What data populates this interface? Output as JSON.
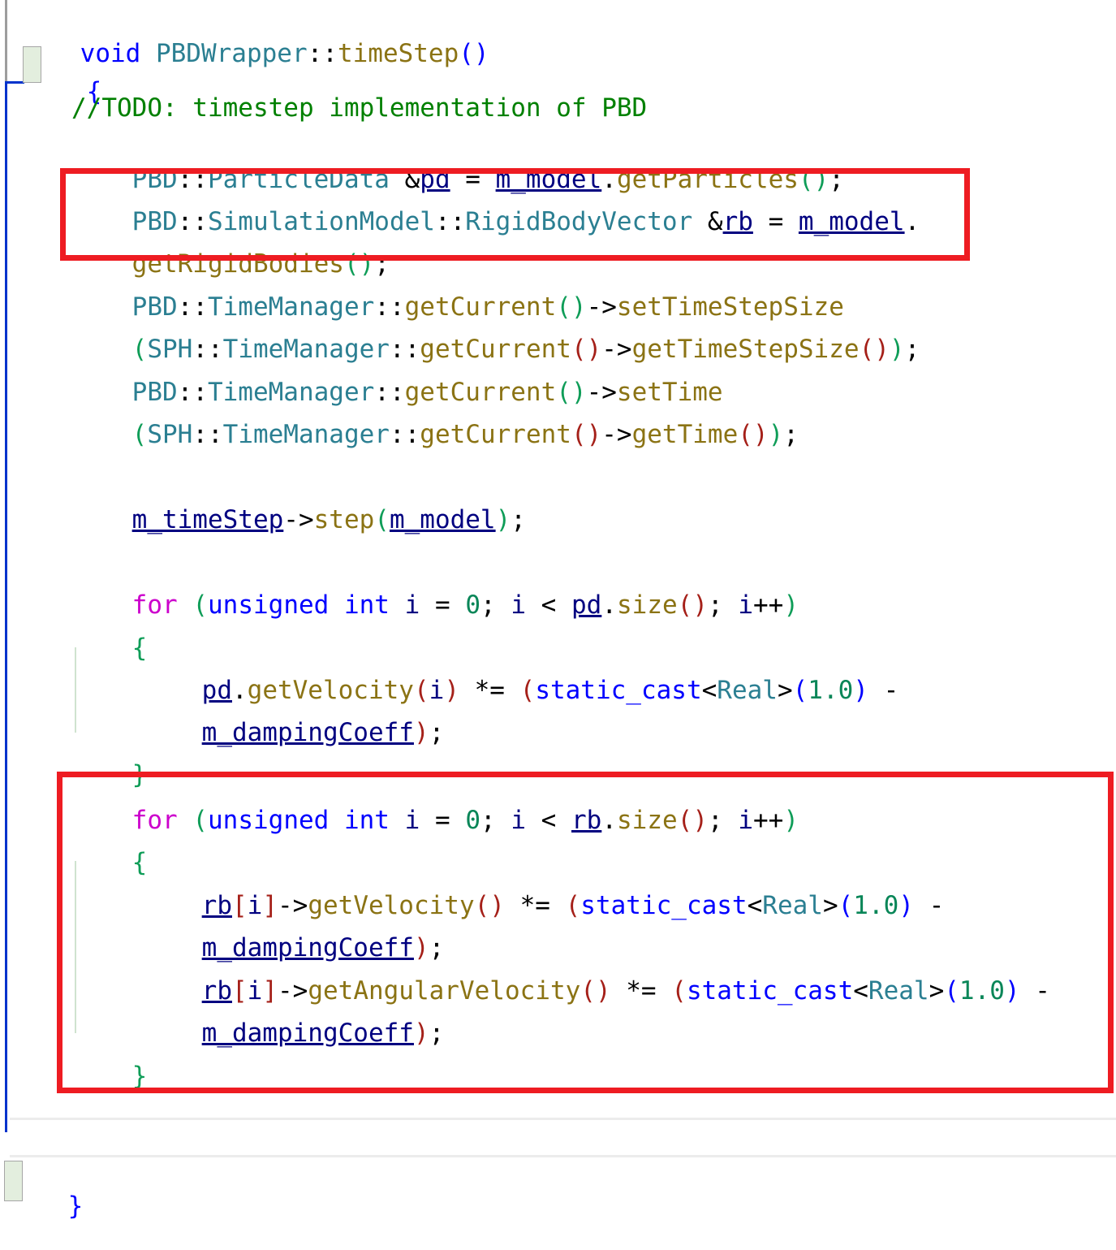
{
  "editor": {
    "language": "cpp",
    "background": "#ffffff",
    "font_size_px": 31,
    "line_height_px": 52
  },
  "colors": {
    "keyword": "#0000ff",
    "control_keyword": "#cc00cc",
    "type": "#2b7f92",
    "function": "#8b7314",
    "variable": "#000080",
    "number": "#098658",
    "comment": "#008000",
    "operator": "#000000",
    "paren_green": "#0f9d58",
    "paren_blue": "#0000ff",
    "paren_red": "#a52019",
    "annotation_red": "#ee1c22",
    "change_bar_blue": "#0033cc",
    "change_bar_gray": "#9d9d9d",
    "brace_match_fill": "#e3eede",
    "indent_guide": "#cfe3cf",
    "separator": "#ececec"
  },
  "code": {
    "lines": [
      {
        "indent": 0,
        "text": "void PBDWrapper::timeStep()"
      },
      {
        "indent": 0,
        "text": "{"
      },
      {
        "indent": 1,
        "text": ""
      },
      {
        "indent": 1,
        "text": "//TODO: timestep implementation of PBD"
      },
      {
        "indent": 1,
        "text": "PBD::ParticleData &pd = m_model.getParticles();"
      },
      {
        "indent": 1,
        "text": "PBD::SimulationModel::RigidBodyVector &rb = m_model."
      },
      {
        "indent": 1,
        "text": "getRigidBodies();"
      },
      {
        "indent": 1,
        "text": "PBD::TimeManager::getCurrent()->setTimeStepSize"
      },
      {
        "indent": 1,
        "text": "(SPH::TimeManager::getCurrent()->getTimeStepSize());"
      },
      {
        "indent": 1,
        "text": "PBD::TimeManager::getCurrent()->setTime"
      },
      {
        "indent": 1,
        "text": "(SPH::TimeManager::getCurrent()->getTime());"
      },
      {
        "indent": 1,
        "text": ""
      },
      {
        "indent": 1,
        "text": "m_timeStep->step(m_model);"
      },
      {
        "indent": 1,
        "text": ""
      },
      {
        "indent": 1,
        "text": "for (unsigned int i = 0; i < pd.size(); i++)"
      },
      {
        "indent": 1,
        "text": "{"
      },
      {
        "indent": 2,
        "text": "pd.getVelocity(i) *= (static_cast<Real>(1.0) -"
      },
      {
        "indent": 2,
        "text": "m_dampingCoeff);"
      },
      {
        "indent": 1,
        "text": "}"
      },
      {
        "indent": 1,
        "text": "for (unsigned int i = 0; i < rb.size(); i++)"
      },
      {
        "indent": 1,
        "text": "{"
      },
      {
        "indent": 2,
        "text": "rb[i]->getVelocity() *= (static_cast<Real>(1.0) -"
      },
      {
        "indent": 2,
        "text": "m_dampingCoeff);"
      },
      {
        "indent": 2,
        "text": "rb[i]->getAngularVelocity() *= (static_cast<Real>(1.0) -"
      },
      {
        "indent": 2,
        "text": "m_dampingCoeff);"
      },
      {
        "indent": 1,
        "text": "}"
      },
      {
        "indent": 0,
        "text": "}"
      }
    ],
    "l0": "void PBDWrapper::timeStep()",
    "l1": "{",
    "l3": "//TODO: timestep implementation of PBD",
    "l4": "PBD::ParticleData &pd = m_model.getParticles();",
    "l5": "PBD::SimulationModel::RigidBodyVector &rb = m_model.",
    "l6": "getRigidBodies();",
    "l7": "PBD::TimeManager::getCurrent()->setTimeStepSize",
    "l8": "(SPH::TimeManager::getCurrent()->getTimeStepSize());",
    "l9": "PBD::TimeManager::getCurrent()->setTime",
    "l10": "(SPH::TimeManager::getCurrent()->getTime());",
    "l12": "m_timeStep->step(m_model);",
    "l14": "for (unsigned int i = 0; i < pd.size(); i++)",
    "l15": "{",
    "l16": "pd.getVelocity(i) *= (static_cast<Real>(1.0) -",
    "l17": "m_dampingCoeff);",
    "l18": "}",
    "l19": "for (unsigned int i = 0; i < rb.size(); i++)",
    "l20": "{",
    "l21": "rb[i]->getVelocity() *= (static_cast<Real>(1.0) -",
    "l22": "m_dampingCoeff);",
    "l23": "rb[i]->getAngularVelocity() *= (static_cast<Real>(1.0) -",
    "l24": "m_dampingCoeff);",
    "l25": "}",
    "l26": "}"
  },
  "annotations": {
    "box1": {
      "label": "rigid-body-vector-declaration"
    },
    "box2": {
      "label": "rigid-body-damping-loop"
    }
  }
}
